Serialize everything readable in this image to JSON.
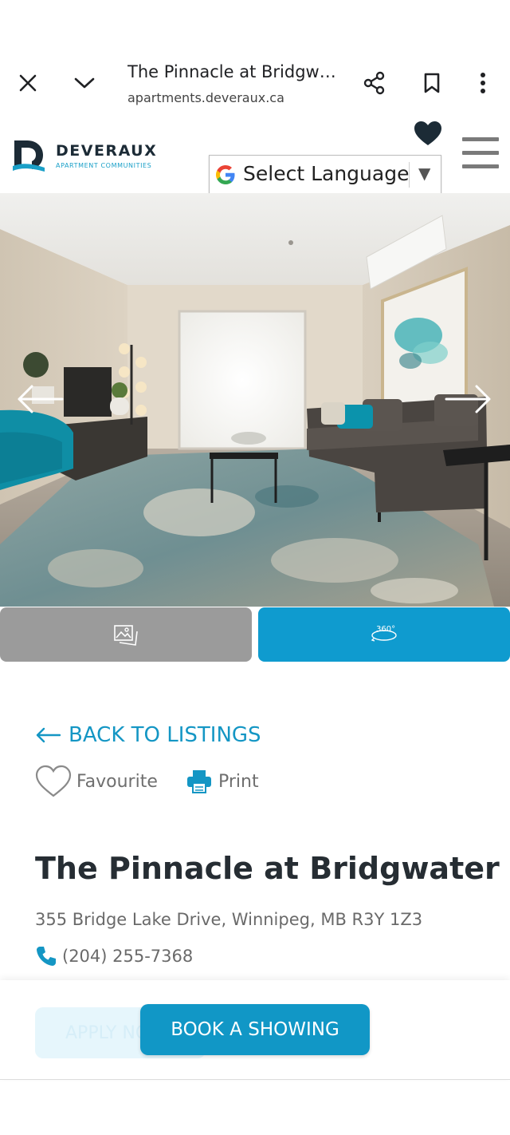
{
  "browser": {
    "title": "The Pinnacle at Bridgwater",
    "url": "apartments.deveraux.ca",
    "icons": [
      "close-icon",
      "chevron-down-icon",
      "share-icon",
      "bookmark-icon",
      "more-vert-icon"
    ]
  },
  "header": {
    "brand_name": "DEVERAUX",
    "brand_tagline": "APARTMENT COMMUNITIES",
    "language_select": "Select Language",
    "language_arrow": "▼",
    "icons": [
      "heart-icon",
      "hamburger-menu-icon"
    ]
  },
  "gallery": {
    "prev_icon": "arrow-left-icon",
    "next_icon": "arrow-right-icon",
    "photos_icon": "photos-icon",
    "tour_icon": "360-tour-icon",
    "tour_label": "360°"
  },
  "listing": {
    "back_label": "BACK TO LISTINGS",
    "favourite_label": "Favourite",
    "print_label": "Print",
    "name": "The Pinnacle at Bridgwater",
    "address": "355 Bridge Lake Drive, Winnipeg, MB R3Y 1Z3",
    "phone": "(204) 255-7368"
  },
  "actions": {
    "apply_label": "APPLY NOW",
    "book_label": "BOOK A SHOWING"
  },
  "colors": {
    "accent": "#1496c4",
    "gallery_inactive": "#9b9b9b",
    "gallery_active": "#0f9bcf",
    "title": "#262d33"
  }
}
